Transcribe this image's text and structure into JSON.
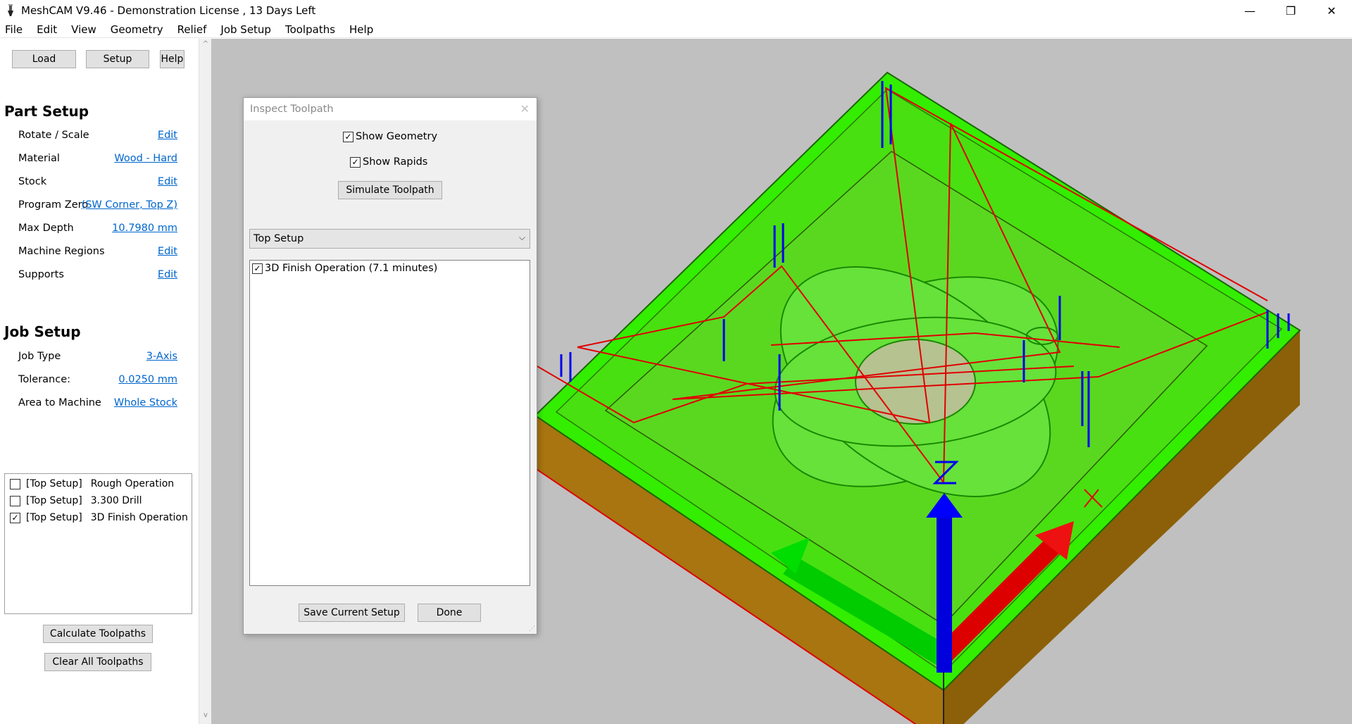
{
  "window": {
    "title": "MeshCAM V9.46 - Demonstration License  , 13 Days Left",
    "minimize_glyph": "—",
    "restore_glyph": "❐",
    "close_glyph": "✕"
  },
  "menu": [
    "File",
    "Edit",
    "View",
    "Geometry",
    "Relief",
    "Job Setup",
    "Toolpaths",
    "Help"
  ],
  "toolbar": {
    "load": "Load",
    "setup": "Setup",
    "help": "Help"
  },
  "part_setup": {
    "title": "Part Setup",
    "rows": [
      {
        "label": "Rotate / Scale",
        "value": "Edit"
      },
      {
        "label": "Material",
        "value": "Wood - Hard"
      },
      {
        "label": "Stock",
        "value": "Edit"
      },
      {
        "label": "Program Zero",
        "value": " (SW Corner, Top Z)"
      },
      {
        "label": "Max Depth",
        "value": "10.7980 mm"
      },
      {
        "label": "Machine Regions",
        "value": "Edit"
      },
      {
        "label": "Supports",
        "value": "Edit"
      }
    ]
  },
  "job_setup": {
    "title": "Job Setup",
    "rows": [
      {
        "label": "Job Type",
        "value": "3-Axis"
      },
      {
        "label": "Tolerance:",
        "value": "0.0250 mm"
      },
      {
        "label": "Area to Machine",
        "value": "Whole Stock"
      }
    ]
  },
  "operations": [
    {
      "setup": "[Top Setup]",
      "name": "Rough Operation",
      "checked": false
    },
    {
      "setup": "[Top Setup]",
      "name": "3.300 Drill",
      "checked": false
    },
    {
      "setup": "[Top Setup]",
      "name": "3D Finish Operation",
      "checked": true
    }
  ],
  "actions": {
    "calculate": "Calculate Toolpaths",
    "clear": "Clear All Toolpaths"
  },
  "dialog": {
    "title": "Inspect Toolpath",
    "show_geometry": "Show Geometry",
    "show_rapids": "Show Rapids",
    "simulate": "Simulate Toolpath",
    "setup_select": "Top Setup",
    "list_items": [
      {
        "label": "3D Finish Operation (7.1 minutes)",
        "checked": true
      }
    ],
    "save": "Save Current Setup",
    "done": "Done"
  },
  "colors": {
    "viewport_bg": "#c0c0c0",
    "stock_side": "#a87510",
    "toolpath_green": "#33ee00",
    "rapid_red": "#e00000",
    "plunge_blue": "#0000ee",
    "link_blue": "#0066cc"
  }
}
